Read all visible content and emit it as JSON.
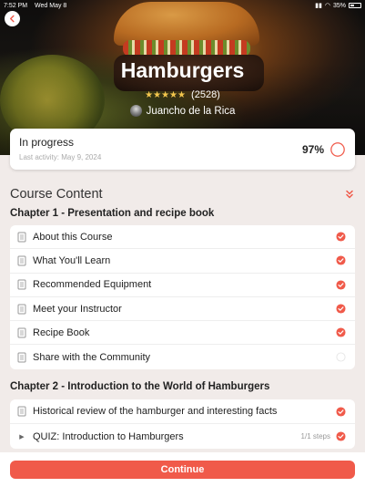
{
  "status_bar": {
    "time": "7:52 PM",
    "date": "Wed May 8",
    "battery": "35%"
  },
  "course": {
    "title": "Hamburgers",
    "rating_count": "(2528)",
    "stars": "★★★★★",
    "author": "Juancho de la Rica"
  },
  "progress": {
    "status": "In progress",
    "last_activity_label": "Last activity:",
    "last_activity_date": "May 9, 2024",
    "percent_label": "97%",
    "percent_value": 0.97
  },
  "content": {
    "title": "Course Content",
    "chapters": [
      {
        "title": "Chapter 1 - Presentation and recipe book",
        "lessons": [
          {
            "label": "About this Course",
            "completed": true
          },
          {
            "label": "What You'll Learn",
            "completed": true
          },
          {
            "label": "Recommended Equipment",
            "completed": true
          },
          {
            "label": "Meet your Instructor",
            "completed": true
          },
          {
            "label": "Recipe Book",
            "completed": true
          },
          {
            "label": "Share with the Community",
            "completed": false
          }
        ]
      },
      {
        "title": "Chapter 2 -  Introduction to the World of Hamburgers",
        "lessons": [
          {
            "label": "Historical review of the hamburger and interesting facts",
            "completed": true
          },
          {
            "label": "QUIZ: Introduction to Hamburgers",
            "steps": "1/1 steps",
            "completed": true,
            "type": "quiz"
          }
        ]
      }
    ]
  },
  "actions": {
    "continue_label": "Continue"
  },
  "colors": {
    "accent": "#f05a4a",
    "background": "#f1ebe9",
    "star": "#f3c64d"
  }
}
